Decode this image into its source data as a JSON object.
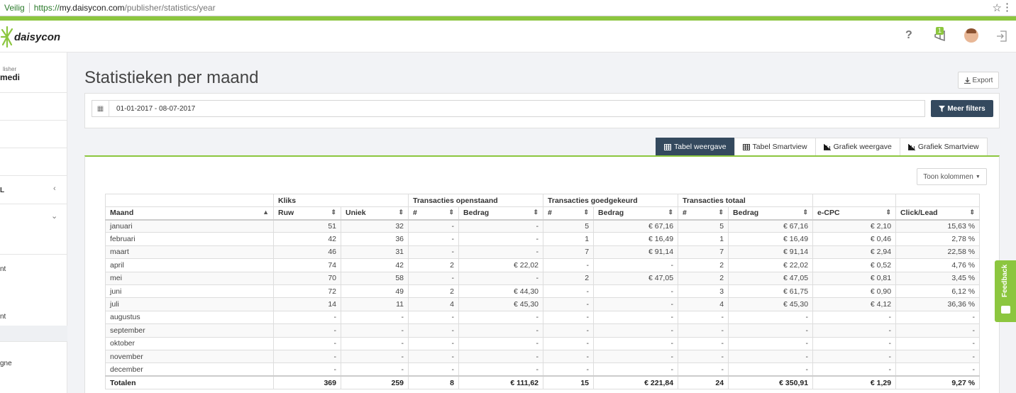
{
  "browser": {
    "secure_label": "Veilig",
    "url_scheme": "https://",
    "url_host": "my.daisycon.com",
    "url_path": "/publisher/statistics/year"
  },
  "header": {
    "logo_text": "daisycon",
    "notification_count": "1",
    "brand_color": "#8cc63f"
  },
  "sidebar": {
    "publisher_label": "lisher",
    "publisher_name": "medi",
    "section_label": "L",
    "items": [
      "nt",
      "nt",
      "gne"
    ]
  },
  "page": {
    "title": "Statistieken per maand",
    "export_label": "Export",
    "date_range": "01-01-2017 - 08-07-2017",
    "more_filters_label": "Meer filters",
    "columns_button": "Toon kolommen"
  },
  "tabs": [
    {
      "label": "Tabel weergave",
      "icon": "table-icon",
      "active": true
    },
    {
      "label": "Tabel Smartview",
      "icon": "table-icon",
      "active": false
    },
    {
      "label": "Grafiek weergave",
      "icon": "bar-chart-icon",
      "active": false
    },
    {
      "label": "Grafiek Smartview",
      "icon": "bar-chart-icon",
      "active": false
    }
  ],
  "table": {
    "groups": {
      "kliks": "Kliks",
      "openstaand": "Transacties openstaand",
      "goedgekeurd": "Transacties goedgekeurd",
      "totaal": "Transacties totaal"
    },
    "columns": [
      "Maand",
      "Ruw",
      "Uniek",
      "#",
      "Bedrag",
      "#",
      "Bedrag",
      "#",
      "Bedrag",
      "e-CPC",
      "Click/Lead"
    ],
    "rows": [
      [
        "januari",
        "51",
        "32",
        "-",
        "-",
        "5",
        "€ 67,16",
        "5",
        "€ 67,16",
        "€ 2,10",
        "15,63 %"
      ],
      [
        "februari",
        "42",
        "36",
        "-",
        "-",
        "1",
        "€ 16,49",
        "1",
        "€ 16,49",
        "€ 0,46",
        "2,78 %"
      ],
      [
        "maart",
        "46",
        "31",
        "-",
        "-",
        "7",
        "€ 91,14",
        "7",
        "€ 91,14",
        "€ 2,94",
        "22,58 %"
      ],
      [
        "april",
        "74",
        "42",
        "2",
        "€ 22,02",
        "-",
        "-",
        "2",
        "€ 22,02",
        "€ 0,52",
        "4,76 %"
      ],
      [
        "mei",
        "70",
        "58",
        "-",
        "-",
        "2",
        "€ 47,05",
        "2",
        "€ 47,05",
        "€ 0,81",
        "3,45 %"
      ],
      [
        "juni",
        "72",
        "49",
        "2",
        "€ 44,30",
        "-",
        "-",
        "3",
        "€ 61,75",
        "€ 0,90",
        "6,12 %"
      ],
      [
        "juli",
        "14",
        "11",
        "4",
        "€ 45,30",
        "-",
        "-",
        "4",
        "€ 45,30",
        "€ 4,12",
        "36,36 %"
      ],
      [
        "augustus",
        "-",
        "-",
        "-",
        "-",
        "-",
        "-",
        "-",
        "-",
        "-",
        "-"
      ],
      [
        "september",
        "-",
        "-",
        "-",
        "-",
        "-",
        "-",
        "-",
        "-",
        "-",
        "-"
      ],
      [
        "oktober",
        "-",
        "-",
        "-",
        "-",
        "-",
        "-",
        "-",
        "-",
        "-",
        "-"
      ],
      [
        "november",
        "-",
        "-",
        "-",
        "-",
        "-",
        "-",
        "-",
        "-",
        "-",
        "-"
      ],
      [
        "december",
        "-",
        "-",
        "-",
        "-",
        "-",
        "-",
        "-",
        "-",
        "-",
        "-"
      ]
    ],
    "totals": [
      "Totalen",
      "369",
      "259",
      "8",
      "€ 111,62",
      "15",
      "€ 221,84",
      "24",
      "€ 350,91",
      "€ 1,29",
      "9,27 %"
    ]
  },
  "feedback_label": "Feedback"
}
